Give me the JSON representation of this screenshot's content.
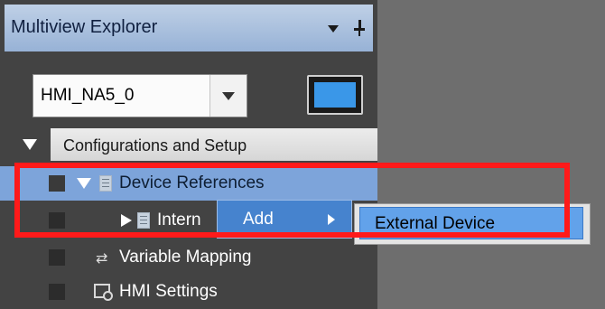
{
  "explorer": {
    "title": "Multiview Explorer",
    "device_select": {
      "value": "HMI_NA5_0"
    }
  },
  "tree": {
    "configurations": "Configurations and Setup",
    "device_references": "Device References",
    "internal_device": "Intern",
    "variable_mapping": "Variable Mapping",
    "hmi_settings": "HMI Settings"
  },
  "context_menu": {
    "add": "Add",
    "submenu_external_device": "External Device"
  },
  "colors": {
    "accent": "#4683ce",
    "selection": "#7da4da",
    "highlight_frame": "#ff1a1a"
  },
  "icons": [
    "pin-icon",
    "dropdown-arrow-icon",
    "monitor-icon",
    "document-icon",
    "variable-mapping-icon",
    "hmi-settings-icon"
  ]
}
